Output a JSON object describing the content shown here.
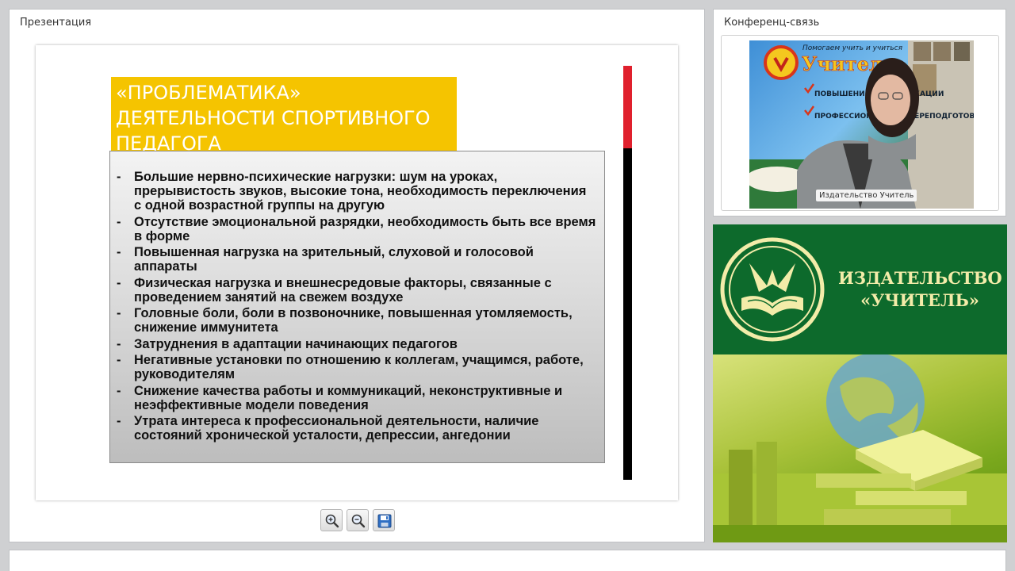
{
  "presentation_panel": {
    "title": "Презентация"
  },
  "slide": {
    "title": "«ПРОБЛЕМАТИКА»\nДЕЯТЕЛЬНОСТИ СПОРТИВНОГО\nПЕДАГОГА",
    "bullet_marker": "-",
    "bullets": [
      "Большие нервно-психические нагрузки: шум на уроках, прерывистость звуков, высокие тона, необходимость переключения с одной возрастной группы на другую",
      "Отсутствие эмоциональной разрядки, необходимость быть все время в форме",
      "Повышенная нагрузка на зрительный, слуховой и голосовой аппараты",
      "Физическая нагрузка и внешнесредовые факторы, связанные с проведением занятий на свежем воздухе",
      "Головные боли, боли в позвоночнике, повышенная утомляемость, снижение иммунитета",
      "Затруднения в адаптации начинающих педагогов",
      "Негативные установки по отношению к коллегам, учащимся, работе, руководителям",
      "Снижение качества работы и коммуникаций, неконструктивные и неэффективные модели поведения",
      "Утрата интереса к профессиональной деятельности, наличие состояний хронической усталости, депрессии, ангедонии"
    ],
    "colors": {
      "title_bg": "#f5c400",
      "red_bar": "#e0202d",
      "black_bar": "#000000"
    }
  },
  "toolbar": {
    "zoom_in_icon": "zoom-in-icon",
    "zoom_out_icon": "zoom-out-icon",
    "save_icon": "save-icon"
  },
  "conference_panel": {
    "title": "Конференц-связь",
    "participant_name": "Издательство Учитель",
    "video_banner_lines": [
      "Помогаем учить и учиться",
      "Учитель",
      "ПОВЫШЕНИЕ КВАЛИФИКАЦИИ",
      "ПРОФЕССИОНАЛЬНАЯ ПЕРЕПОДГОТОВКА"
    ]
  },
  "publisher": {
    "name": "ИЗДАТЕЛЬСТВО\n«УЧИТЕЛЬ»",
    "logo_icon": "book-logo-icon",
    "colors": {
      "green": "#0d6a2c",
      "gold": "#f3eca9"
    }
  }
}
